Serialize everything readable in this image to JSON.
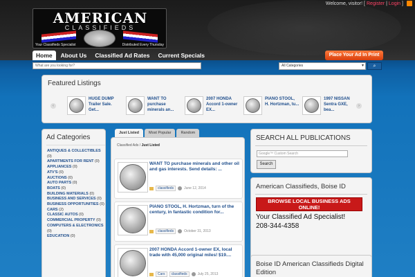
{
  "topbar": {
    "welcome": "Welcome, visitor!",
    "open": "[",
    "register": "Register",
    "sep": "|",
    "login": "Login",
    "close": "]"
  },
  "logo": {
    "title": "AMERICAN",
    "subtitle": "CLASSIFIEDS",
    "tag_left": "Your Classifieds Specialist",
    "tag_right": "Distributed Every Thursday"
  },
  "nav": {
    "items": [
      "Home",
      "About Us",
      "Classified Ad Rates",
      "Current Specials"
    ],
    "place_ad": "Place Your Ad In Print"
  },
  "search": {
    "placeholder": "What are you looking for?",
    "category": "All Categories",
    "button_icon": "search-icon"
  },
  "featured": {
    "title": "Featured Listings",
    "items": [
      "HUGE DUMP Trailer Sale. Get...",
      "WANT TO purchase minerals an...",
      "2007 HONDA Accord 1-owner EX...",
      "PIANO STOOL, H. Hortzman, tu...",
      "1997 NISSAN Sentra GXE, bea..."
    ]
  },
  "categories": {
    "title": "Ad Categories",
    "items": [
      {
        "name": "ANTIQUES & COLLECTIBLES",
        "count": "(0)"
      },
      {
        "name": "APARTMENTS FOR RENT",
        "count": "(0)"
      },
      {
        "name": "APPLIANCES",
        "count": "(0)"
      },
      {
        "name": "ATV'S",
        "count": "(0)"
      },
      {
        "name": "AUCTIONS",
        "count": "(0)"
      },
      {
        "name": "AUTO PARTS",
        "count": "(0)"
      },
      {
        "name": "BOATS",
        "count": "(0)"
      },
      {
        "name": "BUILDING MATERIALS",
        "count": "(0)"
      },
      {
        "name": "BUSINESS AND SERVICES",
        "count": "(0)"
      },
      {
        "name": "BUSINESS OPPORTUNITIES",
        "count": "(0)"
      },
      {
        "name": "CARS",
        "count": "(2)"
      },
      {
        "name": "CLASSIC AUTOS",
        "count": "(0)"
      },
      {
        "name": "COMMERCIAL PROPERTY",
        "count": "(0)"
      },
      {
        "name": "COMPUTERS & ELECTRONICS",
        "count": "(0)"
      },
      {
        "name": "EDUCATION",
        "count": "(0)"
      }
    ]
  },
  "tabs": [
    "Just Listed",
    "Most Popular",
    "Random"
  ],
  "breadcrumb": {
    "root": "Classified Ads",
    "sep": " / ",
    "current": "Just Listed"
  },
  "listings": [
    {
      "title": "WANT TO purchase minerals and other oil and gas interests. Send details: ...",
      "cats": [
        "classifieds"
      ],
      "date": "June 12, 2014"
    },
    {
      "title": "PIANO STOOL, H. Hortzman, turn of the century, in fantastic condition for...",
      "cats": [
        "classifieds"
      ],
      "date": "October 31, 2013"
    },
    {
      "title": "2007 HONDA Accord 1-owner EX, local trade with 45,000 original miles! $19....",
      "cats": [
        "Cars",
        "classifieds"
      ],
      "date": "July 25, 2013"
    }
  ],
  "side_search": {
    "title": "SEARCH ALL PUBLICATIONS",
    "placeholder": "Google™ Custom Search",
    "button": "Search"
  },
  "side_boise": {
    "title": "American Classifieds, Boise ID",
    "banner": "BROWSE LOCAL BUSINESS ADS ONLINE!",
    "specialist": "Your Classified Ad Specialist!",
    "phone": "208-344-4358"
  },
  "side_digital": {
    "title": "Boise ID American Classifieds Digital Edition"
  }
}
